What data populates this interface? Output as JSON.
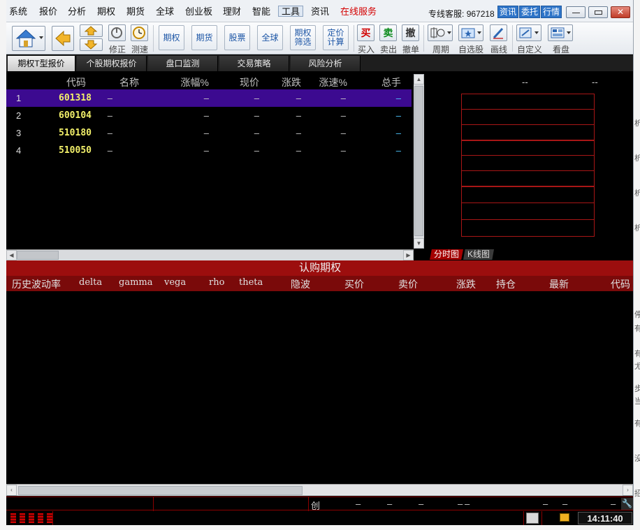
{
  "menu": [
    "系统",
    "报价",
    "分析",
    "期权",
    "期货",
    "全球",
    "创业板",
    "理财",
    "智能",
    "工具",
    "资讯",
    "在线服务"
  ],
  "hotline": {
    "label": "专线客服:",
    "number": "967218"
  },
  "menu_tabs": [
    "资讯",
    "委托",
    "行情"
  ],
  "toolbar": {
    "updown_labels": [
      "修正",
      "测速"
    ],
    "text_buttons": [
      "期权",
      "期货",
      "股票",
      "全球",
      "期权\n筛选",
      "定价\n计算"
    ],
    "trade": [
      {
        "icon": "买",
        "label": "买入"
      },
      {
        "icon": "卖",
        "label": "卖出"
      },
      {
        "icon": "撤",
        "label": "撤单"
      }
    ],
    "period_label": "周期",
    "watchlist_label": "自选股",
    "draw_label": "画线",
    "custom_label": "自定义",
    "board_label": "看盘"
  },
  "tabs": [
    "期权T型报价",
    "个股期权报价",
    "盘口监测",
    "交易策略",
    "风险分析"
  ],
  "quote_table": {
    "headers": [
      "代码",
      "名称",
      "涨幅%",
      "现价",
      "涨跌",
      "涨速%",
      "总手"
    ],
    "rows": [
      {
        "no": "1",
        "code": "601318",
        "name": "–",
        "chg": "–",
        "price": "–",
        "diff": "–",
        "speed": "–",
        "vol": "–"
      },
      {
        "no": "2",
        "code": "600104",
        "name": "–",
        "chg": "–",
        "price": "–",
        "diff": "–",
        "speed": "–",
        "vol": "–"
      },
      {
        "no": "3",
        "code": "510180",
        "name": "–",
        "chg": "–",
        "price": "–",
        "diff": "–",
        "speed": "–",
        "vol": "–"
      },
      {
        "no": "4",
        "code": "510050",
        "name": "–",
        "chg": "–",
        "price": "–",
        "diff": "–",
        "speed": "–",
        "vol": "–"
      }
    ]
  },
  "right_panel": {
    "val1": "--",
    "val2": "--",
    "tab1": "分时图",
    "tab2": "K线图"
  },
  "call_section": {
    "title": "认购期权",
    "headers": [
      "历史波动率",
      "delta",
      "gamma",
      "vega",
      "rho",
      "theta",
      "隐波",
      "买价",
      "卖价",
      "涨跌",
      "持仓",
      "最新",
      "代码"
    ]
  },
  "status": {
    "chuang": "创",
    "dashes": [
      "–",
      "–",
      "–",
      "–",
      "–",
      "–",
      "–",
      "–"
    ],
    "time": "14:11:40"
  },
  "right_edge_fragments": [
    "析",
    "析",
    "析",
    "析",
    "停",
    "有",
    "有",
    "尤",
    "步",
    "当",
    "有",
    "没",
    "招"
  ]
}
